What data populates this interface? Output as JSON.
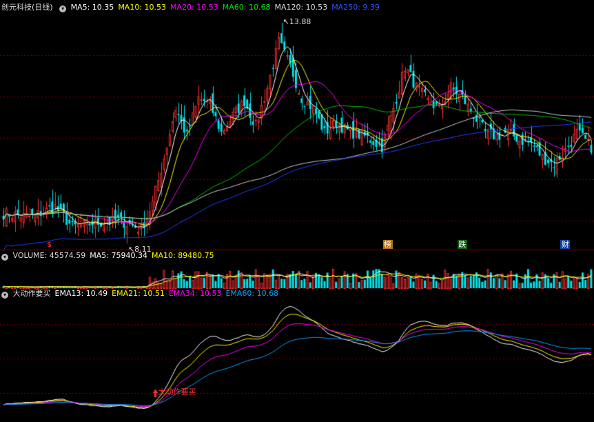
{
  "panel1": {
    "title": "创元科技(日线)",
    "ma_labels": [
      {
        "text": "MA5: 10.35",
        "color": "#ffffff"
      },
      {
        "text": "MA10: 10.53",
        "color": "#ffff00"
      },
      {
        "text": "MA20: 10.53",
        "color": "#ff00ff"
      },
      {
        "text": "MA60: 10.68",
        "color": "#00e000"
      },
      {
        "text": "MA120: 10.53",
        "color": "#dddddd"
      },
      {
        "text": "MA250: 9.39",
        "color": "#3355ff"
      }
    ],
    "high_label": "13.88",
    "low_label": "8.11",
    "events": [
      {
        "label": "$",
        "color": "#ff3030",
        "bg": "transparent",
        "idx": 16
      },
      {
        "label": "榜",
        "color": "#ffffff",
        "bg": "#b07010",
        "idx": 134
      },
      {
        "label": "跌",
        "color": "#ffffff",
        "bg": "#106010",
        "idx": 160
      },
      {
        "label": "财",
        "color": "#ffffff",
        "bg": "#1040a0",
        "idx": 196
      }
    ]
  },
  "panel2": {
    "labels": [
      {
        "text": "VOLUME: 45574.59",
        "color": "#dddddd"
      },
      {
        "text": "MA5: 75940.34",
        "color": "#ffffff"
      },
      {
        "text": "MA10: 89480.75",
        "color": "#ffff00"
      }
    ]
  },
  "panel3": {
    "labels": [
      {
        "text": "大动作要买",
        "color": "#dddddd"
      },
      {
        "text": "EMA13: 10.49",
        "color": "#ffffff"
      },
      {
        "text": "EMA21: 10.51",
        "color": "#ffff00"
      },
      {
        "text": "EMA34: 10.53",
        "color": "#ff00ff"
      },
      {
        "text": "EMA60: 10.68",
        "color": "#00a0ff"
      }
    ],
    "signal_label": "大动作要买"
  },
  "colors": {
    "up": "#ff3030",
    "down": "#00e5ee",
    "grid": "#800000"
  },
  "chart_data": {
    "type": "candlestick",
    "price_axis_range": [
      7.6,
      14.3
    ],
    "volume_axis_range": [
      0,
      160000
    ],
    "ema_axis_range": [
      7.8,
      13.0
    ],
    "anchors": [
      [
        0,
        8.6
      ],
      [
        10,
        8.5
      ],
      [
        18,
        8.8
      ],
      [
        24,
        8.2
      ],
      [
        30,
        8.3
      ],
      [
        40,
        8.4
      ],
      [
        48,
        8.15
      ],
      [
        52,
        8.9
      ],
      [
        56,
        10.2
      ],
      [
        60,
        11.6
      ],
      [
        64,
        10.8
      ],
      [
        68,
        11.9
      ],
      [
        72,
        11.7
      ],
      [
        76,
        10.9
      ],
      [
        80,
        11.4
      ],
      [
        84,
        11.8
      ],
      [
        88,
        11.1
      ],
      [
        92,
        12.2
      ],
      [
        96,
        13.5
      ],
      [
        100,
        12.8
      ],
      [
        104,
        11.9
      ],
      [
        108,
        11.6
      ],
      [
        112,
        10.9
      ],
      [
        116,
        11.2
      ],
      [
        120,
        10.95
      ],
      [
        126,
        10.8
      ],
      [
        132,
        10.5
      ],
      [
        136,
        11.6
      ],
      [
        140,
        12.8
      ],
      [
        144,
        12.2
      ],
      [
        148,
        11.8
      ],
      [
        152,
        11.6
      ],
      [
        156,
        12.2
      ],
      [
        160,
        11.9
      ],
      [
        164,
        11.4
      ],
      [
        168,
        10.9
      ],
      [
        172,
        10.8
      ],
      [
        176,
        10.9
      ],
      [
        180,
        10.7
      ],
      [
        184,
        10.6
      ],
      [
        188,
        10.2
      ],
      [
        192,
        10.0
      ],
      [
        196,
        10.4
      ],
      [
        200,
        10.9
      ],
      [
        205,
        10.5
      ]
    ],
    "bars": 206
  }
}
